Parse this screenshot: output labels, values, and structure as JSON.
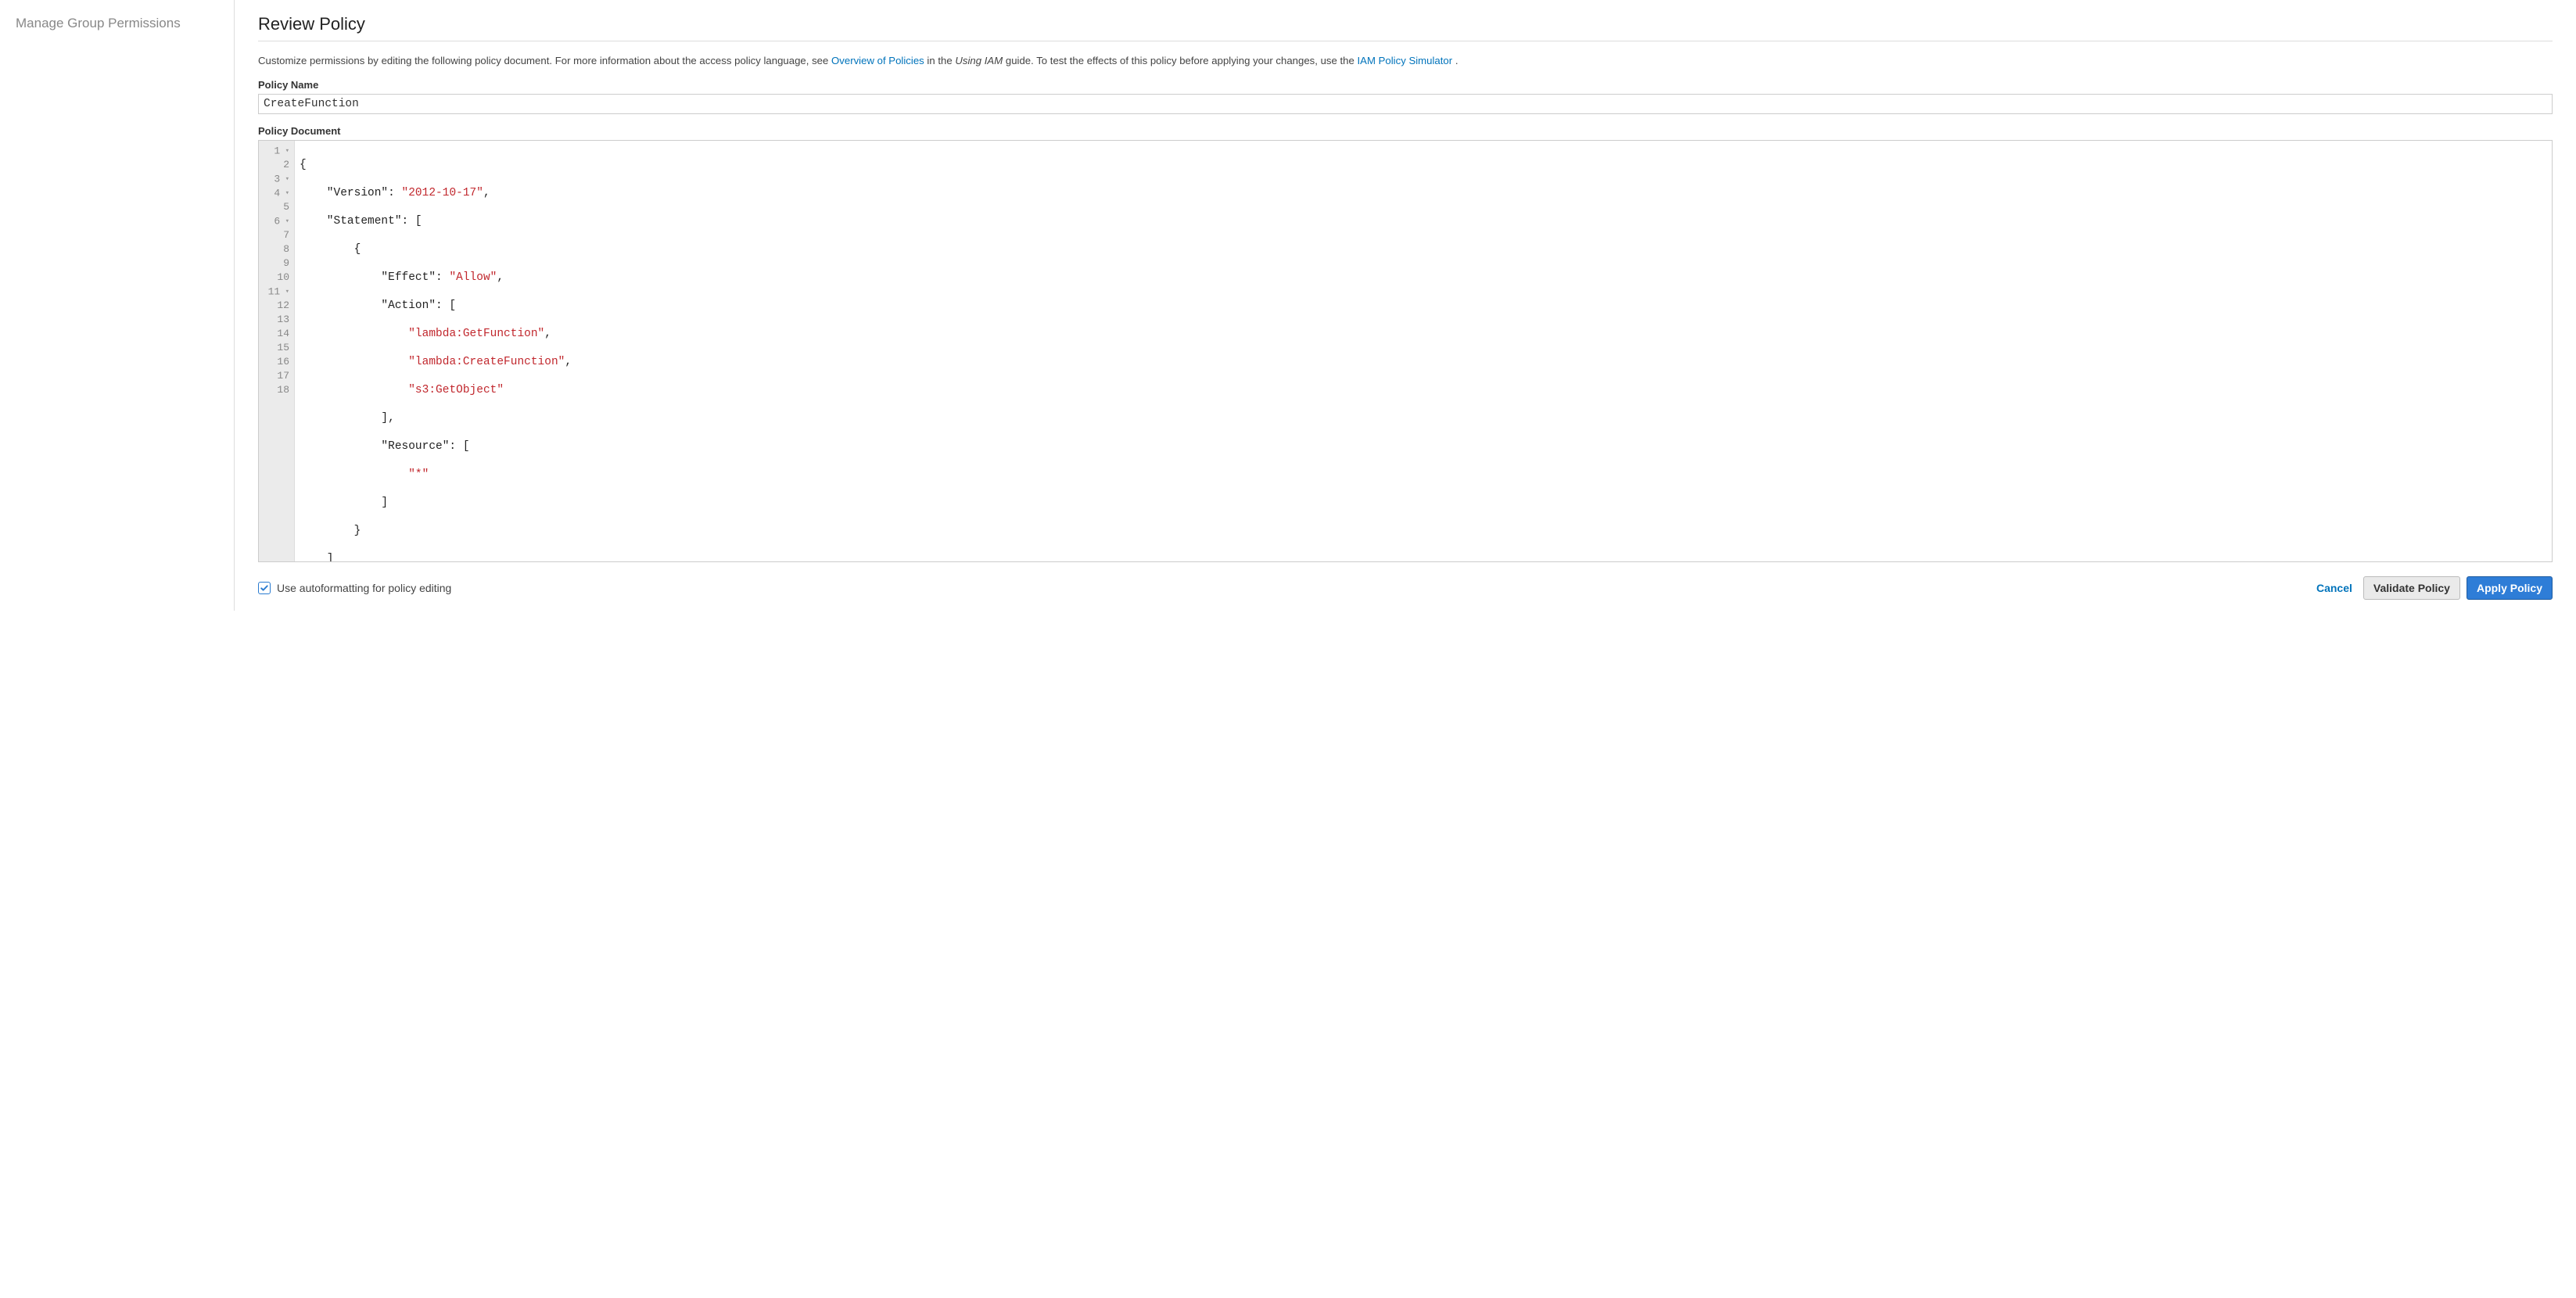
{
  "sidebar": {
    "title": "Manage Group Permissions"
  },
  "page": {
    "title": "Review Policy",
    "desc_pre": "Customize permissions by editing the following policy document. For more information about the access policy language, see ",
    "link1": "Overview of Policies",
    "desc_mid": " in the ",
    "guide_name": "Using IAM",
    "desc_post_guide": " guide. To test the effects of this policy before applying your changes, use the ",
    "link2": "IAM Policy Simulator",
    "dot": "."
  },
  "form": {
    "name_label": "Policy Name",
    "name_value": "CreateFunction",
    "doc_label": "Policy Document"
  },
  "policy_json": {
    "Version": "2012-10-17",
    "Statement": [
      {
        "Effect": "Allow",
        "Action": [
          "lambda:GetFunction",
          "lambda:CreateFunction",
          "s3:GetObject"
        ],
        "Resource": [
          "*"
        ]
      }
    ]
  },
  "editor_lines": {
    "l1": "{",
    "l2a": "    \"Version\": ",
    "l2b": "\"2012-10-17\"",
    "l2c": ",",
    "l3": "    \"Statement\": [",
    "l4": "        {",
    "l5a": "            \"Effect\": ",
    "l5b": "\"Allow\"",
    "l5c": ",",
    "l6": "            \"Action\": [",
    "l7a": "                ",
    "l7b": "\"lambda:GetFunction\"",
    "l7c": ",",
    "l8a": "                ",
    "l8b": "\"lambda:CreateFunction\"",
    "l8c": ",",
    "l9a": "                ",
    "l9b": "\"s3:GetObject\"",
    "l10": "            ],",
    "l11": "            \"Resource\": [",
    "l12a": "                ",
    "l12b": "\"*\"",
    "l13": "            ]",
    "l14": "        }",
    "l15": "    ]",
    "l16": "}",
    "total_lines": 18
  },
  "footer": {
    "checkbox_label": "Use autoformatting for policy editing",
    "checkbox_checked": true,
    "cancel": "Cancel",
    "validate": "Validate Policy",
    "apply": "Apply Policy"
  }
}
